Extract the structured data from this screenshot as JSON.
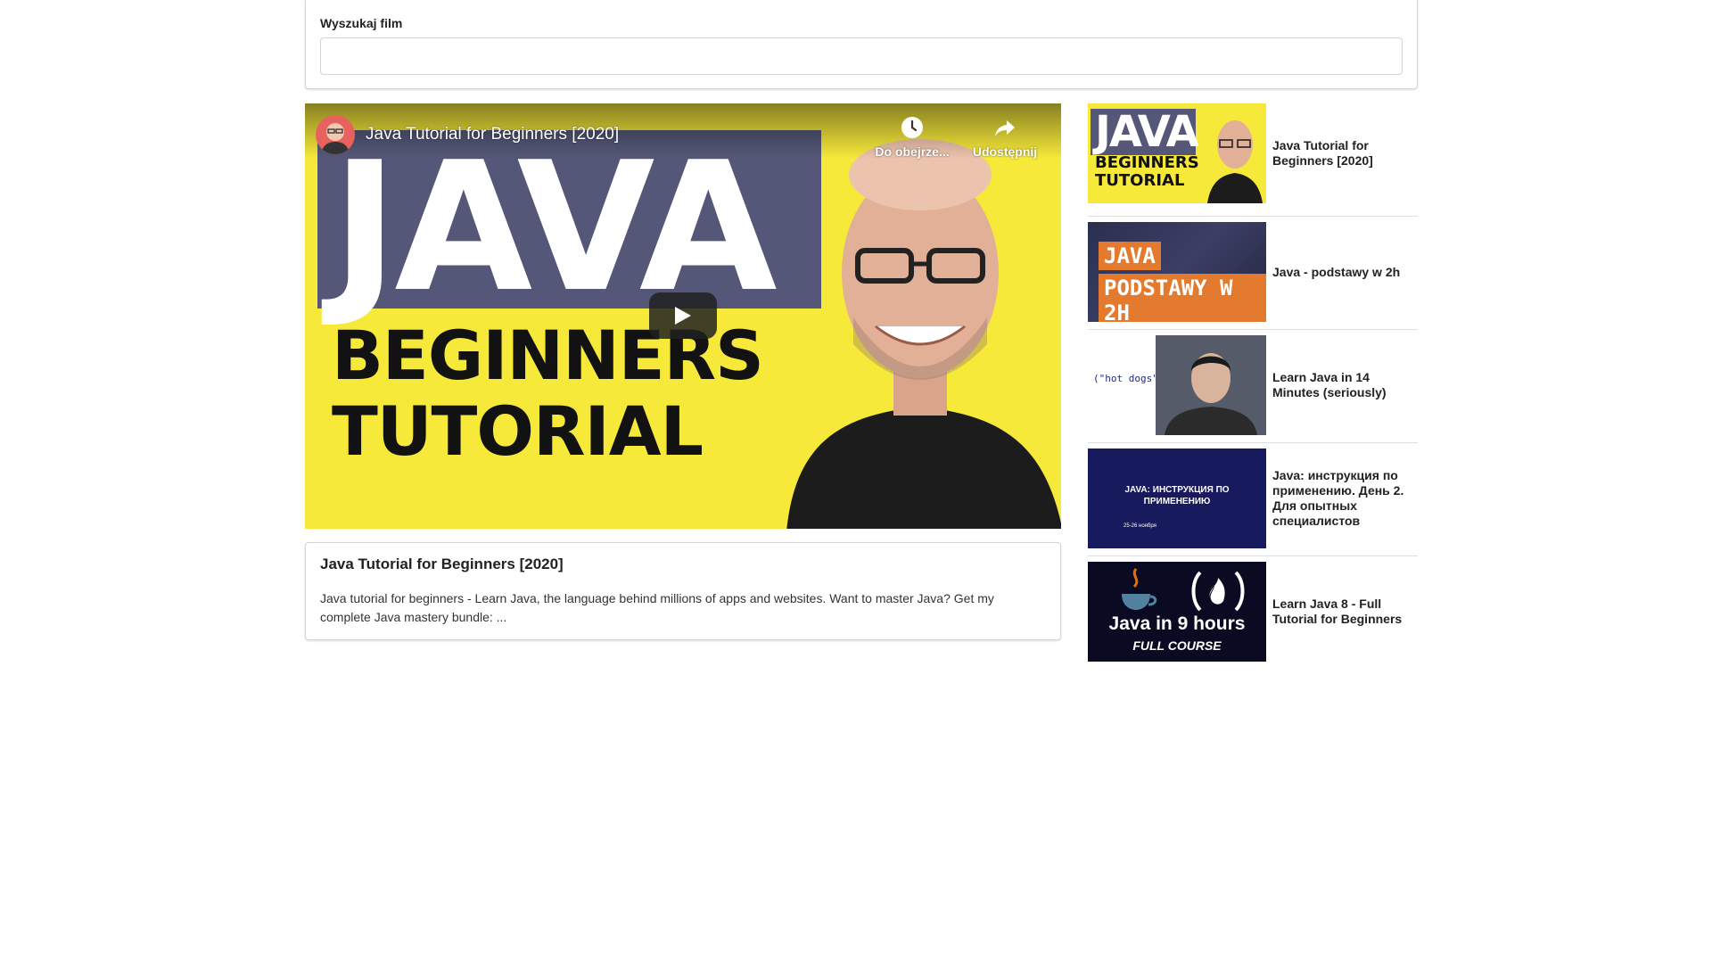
{
  "search": {
    "label": "Wyszukaj film",
    "value": "",
    "placeholder": ""
  },
  "player": {
    "title": "Java Tutorial for Beginners [2020]",
    "thumbnail_big": "JAVA",
    "thumbnail_line1": "BEGINNERS",
    "thumbnail_line2": "TUTORIAL",
    "actions": {
      "watch_later": "Do obejrze...",
      "share": "Udostępnij"
    },
    "colors": {
      "background": "#f6e93a",
      "banner": "#545778"
    }
  },
  "description": {
    "title": "Java Tutorial for Beginners [2020]",
    "text": "Java tutorial for beginners - Learn Java, the language behind millions of apps and websites. Want to master Java? Get my complete Java mastery bundle: ..."
  },
  "videos": [
    {
      "title": "Java Tutorial for Beginners [2020]",
      "thumb": {
        "big": "JAVA",
        "line1": "BEGINNERS",
        "line2": "TUTORIAL"
      }
    },
    {
      "title": "Java - podstawy w 2h",
      "thumb": {
        "line1": "JAVA",
        "line2": "PODSTAWY W 2H"
      }
    },
    {
      "title": "Learn Java in 14 Minutes (seriously)",
      "thumb": {
        "code": "(\"hot dogs\");"
      }
    },
    {
      "title": "Java: инструкция по применению. День 2. Для опытных специалистов",
      "thumb": {
        "label": "JAVA: ИНСТРУКЦИЯ ПО ПРИМЕНЕНИЮ",
        "date": "25-26 ноября"
      }
    },
    {
      "title": "Learn Java 8 - Full Tutorial for Beginners",
      "thumb": {
        "line1": "Java in 9 hours",
        "line2": "FULL COURSE"
      }
    }
  ]
}
